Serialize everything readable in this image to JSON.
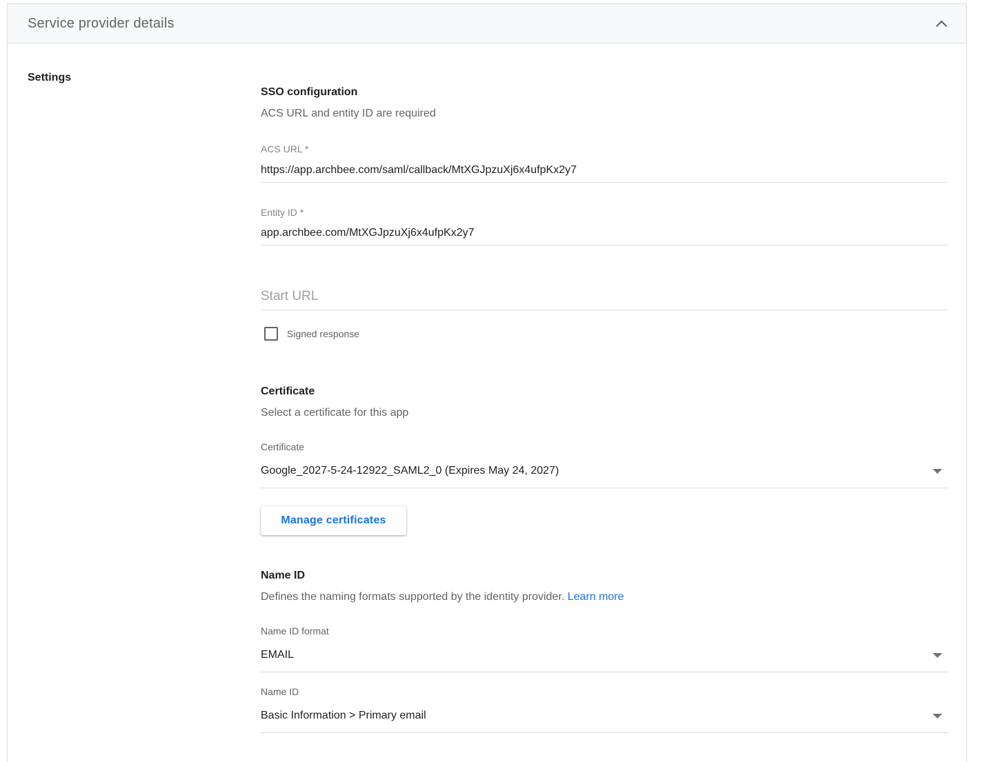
{
  "panel": {
    "title": "Service provider details",
    "settings_label": "Settings"
  },
  "sso": {
    "title": "SSO configuration",
    "subtitle": "ACS URL and entity ID are required",
    "acs_url": {
      "label": "ACS URL *",
      "value": "https://app.archbee.com/saml/callback/MtXGJpzuXj6x4ufpKx2y7"
    },
    "entity_id": {
      "label": "Entity ID *",
      "value": "app.archbee.com/MtXGJpzuXj6x4ufpKx2y7"
    },
    "start_url": {
      "placeholder": "Start URL",
      "value": ""
    },
    "signed_response": {
      "label": "Signed response",
      "checked": false
    }
  },
  "certificate": {
    "title": "Certificate",
    "subtitle": "Select a certificate for this app",
    "select_label": "Certificate",
    "selected": "Google_2027-5-24-12922_SAML2_0 (Expires May 24, 2027)",
    "manage_button": "Manage certificates"
  },
  "name_id": {
    "title": "Name ID",
    "subtitle": "Defines the naming formats supported by the identity provider.",
    "learn_more": "Learn more",
    "format_label": "Name ID format",
    "format_value": "EMAIL",
    "name_id_label": "Name ID",
    "name_id_value": "Basic Information > Primary email"
  },
  "colors": {
    "accent": "#1a73e8",
    "header_bg": "#f8f9fa",
    "border": "#dadce0"
  }
}
